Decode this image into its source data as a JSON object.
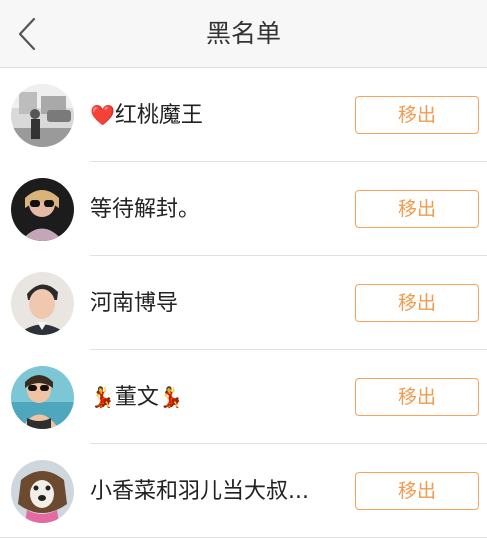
{
  "header": {
    "title": "黑名单"
  },
  "remove_label": "移出",
  "rows": [
    {
      "name": "红桃魔王",
      "prefix": "❤️",
      "suffix": "",
      "avatar": "avatar-street"
    },
    {
      "name": "等待解封。",
      "prefix": "",
      "suffix": "",
      "avatar": "avatar-girl-sunglasses"
    },
    {
      "name": "河南博导",
      "prefix": "",
      "suffix": "",
      "avatar": "avatar-young-man"
    },
    {
      "name": "董文",
      "prefix": "💃",
      "suffix": "💃",
      "avatar": "avatar-woman-beach"
    },
    {
      "name": "小香菜和羽儿当大叔...",
      "prefix": "",
      "suffix": "",
      "avatar": "avatar-dog"
    }
  ]
}
